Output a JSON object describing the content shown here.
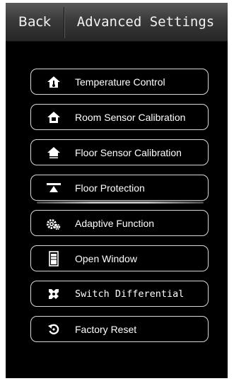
{
  "header": {
    "back_label": "Back",
    "title": "Advanced Settings"
  },
  "menu": {
    "items": [
      {
        "label": "Temperature Control",
        "icon": "home-thermometer-icon"
      },
      {
        "label": "Room Sensor Calibration",
        "icon": "home-sensor-icon"
      },
      {
        "label": "Floor Sensor Calibration",
        "icon": "home-floor-icon"
      },
      {
        "label": "Floor Protection",
        "icon": "floor-protection-icon"
      },
      {
        "label": "Adaptive Function",
        "icon": "gears-icon"
      },
      {
        "label": "Open Window",
        "icon": "window-icon"
      },
      {
        "label": "Switch Differential",
        "icon": "tools-icon"
      },
      {
        "label": "Factory Reset",
        "icon": "reset-icon"
      }
    ]
  },
  "colors": {
    "background": "#000000",
    "header_top": "#5a5a5a",
    "header_bottom": "#262626",
    "button_border": "#d8d8d8",
    "text": "#ffffff"
  }
}
